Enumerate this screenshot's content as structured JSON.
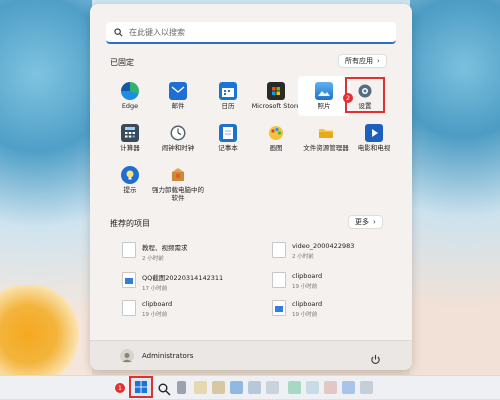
{
  "search": {
    "placeholder": "在此键入以搜索"
  },
  "pinned": {
    "title": "已固定",
    "all_apps_label": "所有应用",
    "apps": [
      {
        "label": "Edge",
        "icon": "edge-icon"
      },
      {
        "label": "邮件",
        "icon": "mail-icon"
      },
      {
        "label": "日历",
        "icon": "calendar-icon"
      },
      {
        "label": "Microsoft Store",
        "icon": "store-icon"
      },
      {
        "label": "照片",
        "icon": "photos-icon"
      },
      {
        "label": "设置",
        "icon": "settings-icon"
      },
      {
        "label": "计算器",
        "icon": "calculator-icon"
      },
      {
        "label": "闹钟和时钟",
        "icon": "clock-icon"
      },
      {
        "label": "记事本",
        "icon": "notepad-icon"
      },
      {
        "label": "画图",
        "icon": "paint-icon"
      },
      {
        "label": "文件资源管理器",
        "icon": "folder-icon"
      },
      {
        "label": "电影和电视",
        "icon": "movies-icon"
      },
      {
        "label": "提示",
        "icon": "tips-icon"
      },
      {
        "label": "强力卸载电脑中的软件",
        "icon": "uninstall-icon"
      }
    ]
  },
  "recommended": {
    "title": "推荐的项目",
    "more_label": "更多",
    "items": [
      {
        "name": "教程、视频需求",
        "time": "2 小时前",
        "icon": "document-icon"
      },
      {
        "name": "video_2000422983",
        "time": "2 小时前",
        "icon": "document-icon"
      },
      {
        "name": "QQ截图20220314142311",
        "time": "17 小时前",
        "icon": "image-file-icon"
      },
      {
        "name": "clipboard",
        "time": "19 小时前",
        "icon": "document-icon"
      },
      {
        "name": "clipboard",
        "time": "19 小时前",
        "icon": "document-icon"
      },
      {
        "name": "clipboard",
        "time": "19 小时前",
        "icon": "image-file-icon"
      }
    ]
  },
  "user": {
    "name": "Administrators"
  },
  "annotations": {
    "badge1": "1",
    "badge2": "2"
  },
  "colors": {
    "accent": "#2f6bc7",
    "highlight": "#e03030"
  }
}
